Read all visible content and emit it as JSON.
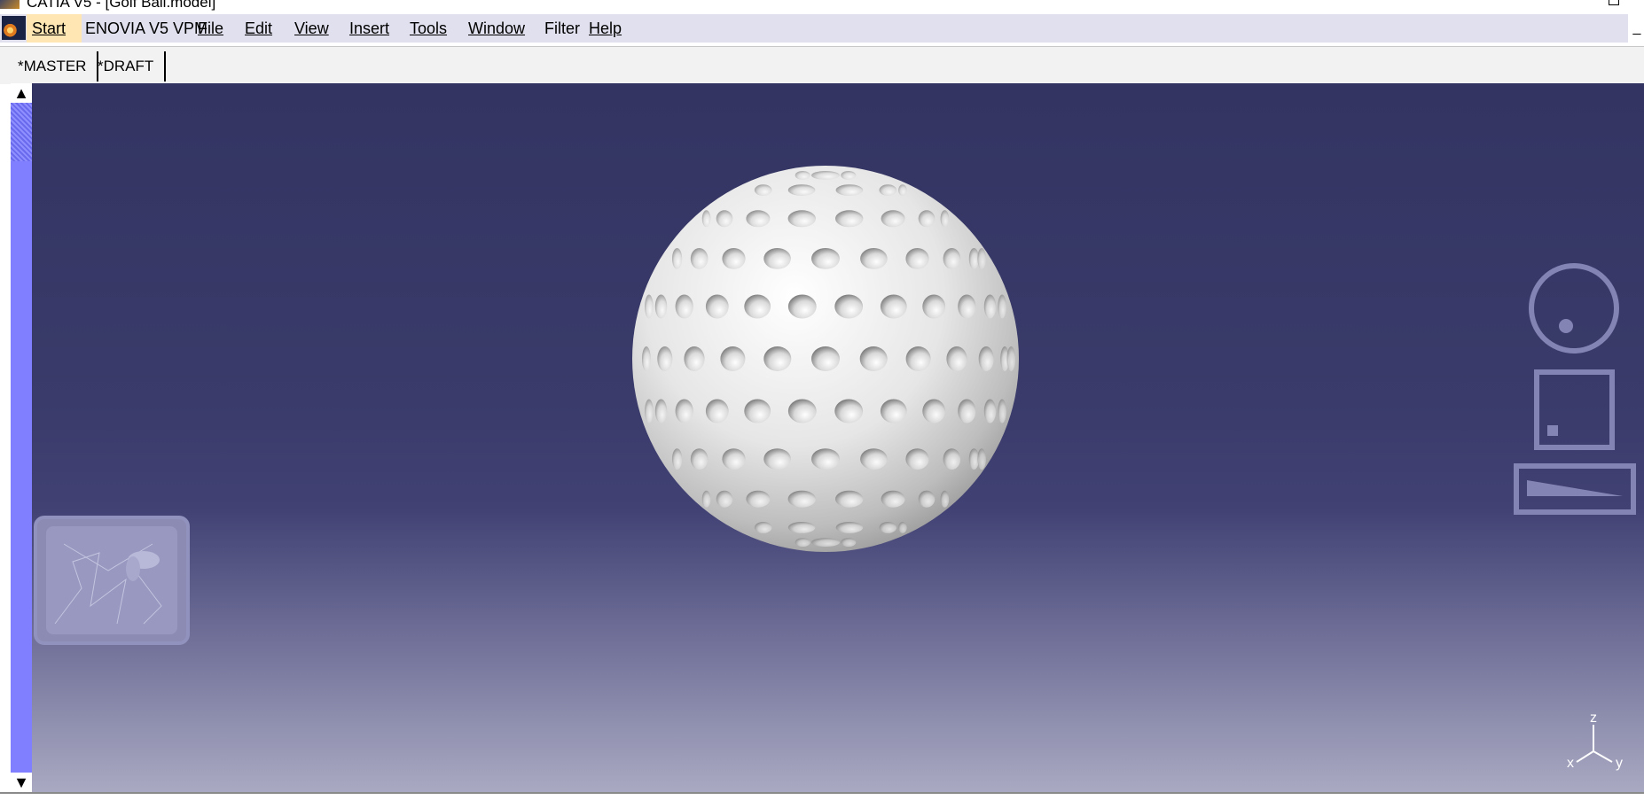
{
  "window": {
    "title": "CATIA V5 - [Golf Ball.model]"
  },
  "menubar": {
    "items": [
      {
        "label": "Start",
        "underline": "S",
        "active": true
      },
      {
        "label": "ENOVIA V5 VPM"
      },
      {
        "label": "File",
        "underline": "F"
      },
      {
        "label": "Edit",
        "underline": "E"
      },
      {
        "label": "View",
        "underline": "V"
      },
      {
        "label": "Insert",
        "underline": "I"
      },
      {
        "label": "Tools",
        "underline": "T"
      },
      {
        "label": "Window",
        "underline": "W"
      },
      {
        "label": "Filter"
      },
      {
        "label": "Help",
        "underline": "H"
      }
    ],
    "minimize_label": "_"
  },
  "tabs": [
    {
      "label": "*MASTER"
    },
    {
      "label": "*DRAFT"
    }
  ],
  "scrollbar": {
    "up_arrow": "▲",
    "down_arrow": "▼"
  },
  "axis": {
    "z": "z",
    "x": "x",
    "y": "y"
  },
  "colors": {
    "viewport_top": "#333462",
    "viewport_bottom": "#a9a9c2",
    "scrollbar": "#7f7fff",
    "active_menu": "#ffe6b3",
    "menubar_bg": "#e0e0ee"
  },
  "icons": {
    "app": "catia-logo-icon",
    "compass": "view-compass-icon",
    "overview": "specification-tree-overview-icon"
  }
}
